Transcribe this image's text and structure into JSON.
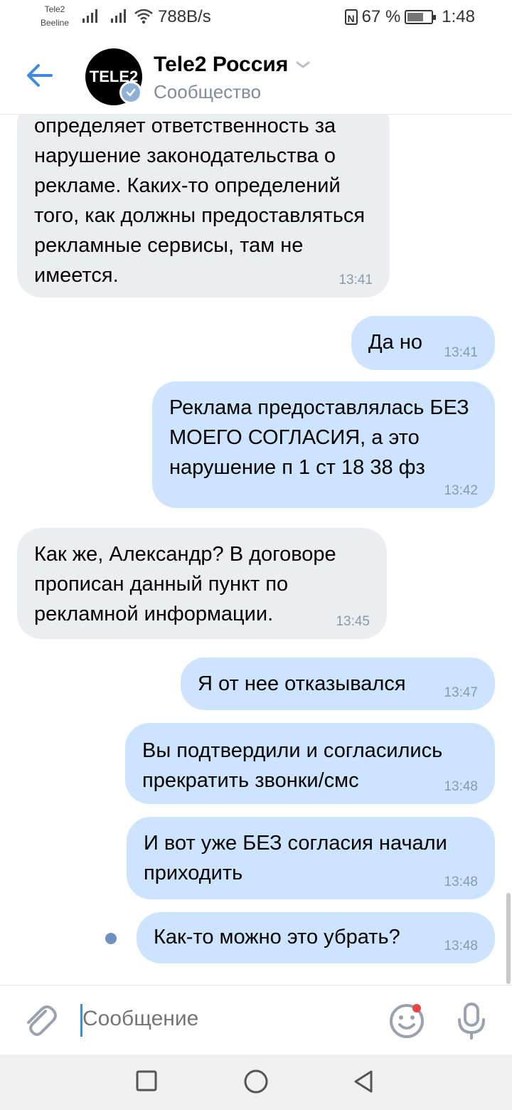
{
  "status": {
    "carrier1": "Tele2",
    "carrier2": "Beeline",
    "speed": "788B/s",
    "battery": "67 %",
    "time": "1:48"
  },
  "header": {
    "title": "Tele2 Россия",
    "subtitle": "Сообщество",
    "avatar_text": "TELE2"
  },
  "messages": [
    {
      "dir": "in",
      "text": "определяет ответственность за нарушение законодательства о рекламе. Каких-то определений того, как должны предоставляться рекламные сервисы, там не имеется.",
      "time": "13:41"
    },
    {
      "dir": "out",
      "text": "Да но",
      "time": "13:41"
    },
    {
      "dir": "out",
      "text": "Реклама предоставлялась БЕЗ МОЕГО СОГЛАСИЯ, а это нарушение п 1 ст 18 38 фз",
      "time": "13:42"
    },
    {
      "dir": "in",
      "text": "Как же, Александр? В договоре прописан данный пункт по рекламной информации.",
      "time": "13:45"
    },
    {
      "dir": "out",
      "text": "Я от нее отказывался",
      "time": "13:47"
    },
    {
      "dir": "out",
      "text": "Вы подтвердили и согласились прекратить звонки/смс",
      "time": "13:48"
    },
    {
      "dir": "out",
      "text": "И вот уже БЕЗ согласия начали приходить",
      "time": "13:48"
    },
    {
      "dir": "out",
      "text": "Как-то можно это убрать?",
      "time": "13:48",
      "unread": true
    }
  ],
  "composer": {
    "placeholder": "Сообщение"
  },
  "icons": {
    "back": "arrow-left-icon",
    "attach": "paperclip-icon",
    "emoji": "smile-icon",
    "mic": "microphone-icon",
    "verified": "check-badge-icon"
  },
  "colors": {
    "accent": "#3f8ae0",
    "incoming_bubble": "#ebedf0",
    "outgoing_bubble": "#cce4ff"
  }
}
